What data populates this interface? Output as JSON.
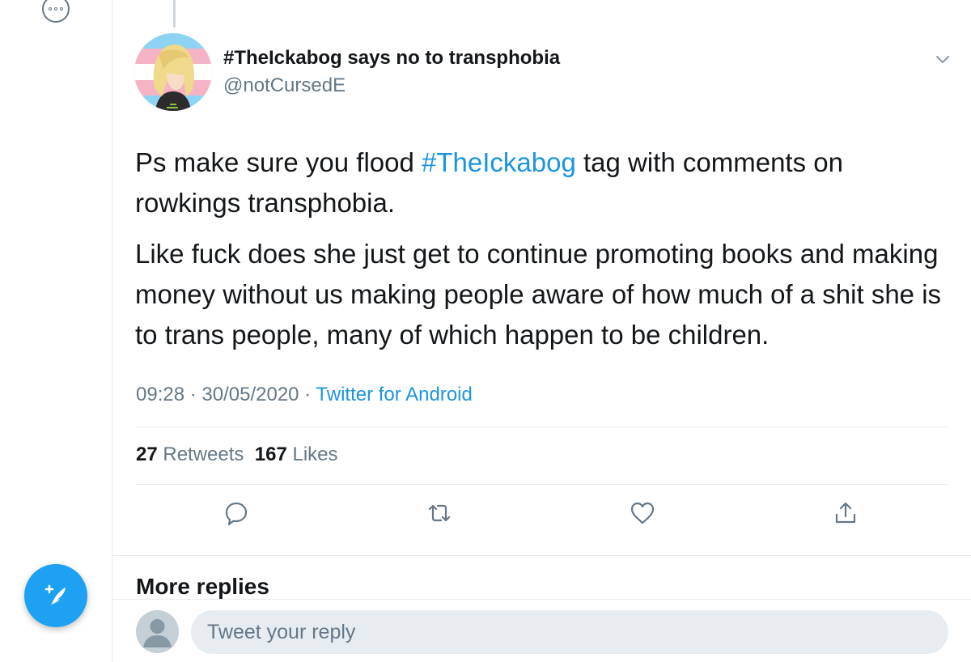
{
  "tweet": {
    "display_name": "#TheIckabog says no to transphobia",
    "username": "@notCursedE",
    "body_p1_before": "Ps make sure you flood ",
    "body_hashtag": "#TheIckabog",
    "body_p1_after": " tag with comments on rowkings transphobia.",
    "body_p2": "Like fuck does she just get to continue promoting books and making money without us making people aware of how much of a shit she is to trans people, many of which happen to be children.",
    "time": "09:28",
    "date": "30/05/2020",
    "separator": " · ",
    "source": "Twitter for Android"
  },
  "stats": {
    "retweets_count": "27",
    "retweets_label": "Retweets",
    "likes_count": "167",
    "likes_label": "Likes"
  },
  "actions": [
    "reply-icon",
    "retweet-icon",
    "like-icon",
    "share-icon"
  ],
  "replies": {
    "heading": "More replies",
    "placeholder": "Tweet your reply"
  },
  "colors": {
    "accent": "#1da1f2",
    "link": "#1b95e0",
    "secondary_text": "#657786",
    "divider": "#e6ecf0"
  }
}
